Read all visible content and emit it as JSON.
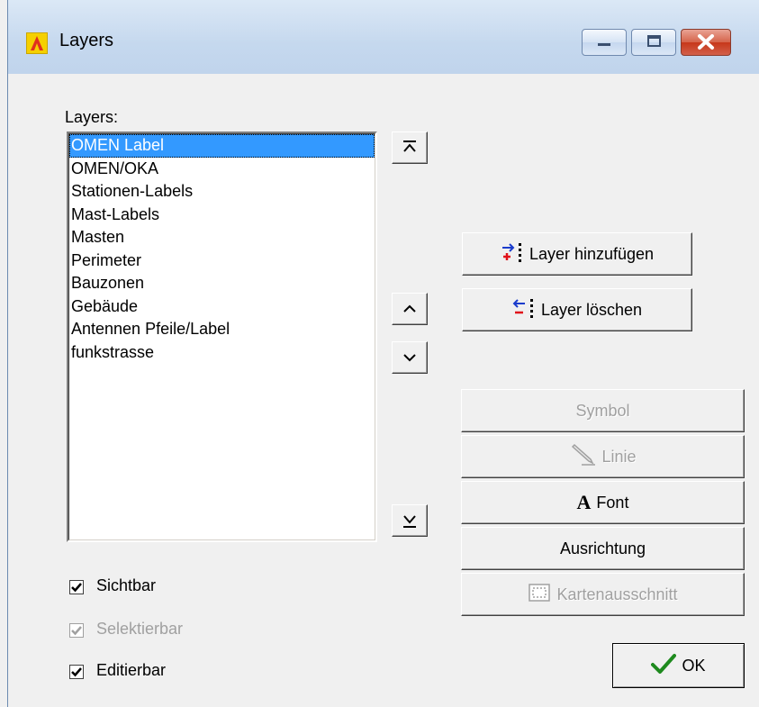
{
  "window": {
    "title": "Layers"
  },
  "layers_label": "Layers:",
  "layers": [
    "OMEN Label",
    "OMEN/OKA",
    "Stationen-Labels",
    "Mast-Labels",
    "Masten",
    "Perimeter",
    "Bauzonen",
    "Gebäude",
    "Antennen Pfeile/Label",
    "funkstrasse"
  ],
  "selected_layer": "OMEN Label",
  "buttons": {
    "add_layer": "Layer hinzufügen",
    "delete_layer": "Layer löschen",
    "symbol": "Symbol",
    "line": "Linie",
    "font": "Font",
    "alignment": "Ausrichtung",
    "map_extent": "Kartenausschnitt",
    "ok": "OK"
  },
  "checkboxes": {
    "visible": {
      "label": "Sichtbar",
      "checked": true,
      "enabled": true
    },
    "selectable": {
      "label": "Selektierbar",
      "checked": true,
      "enabled": false
    },
    "editable": {
      "label": "Editierbar",
      "checked": true,
      "enabled": true
    }
  },
  "colors": {
    "selection": "#3399ff",
    "ok_check": "#1e8a1e",
    "close_button": "#c7371a"
  }
}
